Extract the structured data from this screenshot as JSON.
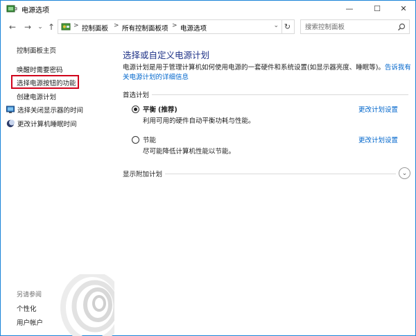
{
  "window": {
    "title": "电源选项",
    "controls": {
      "minimize": "—",
      "maximize": "☐",
      "close": "✕"
    }
  },
  "address": {
    "back": "←",
    "forward": "→",
    "dropdown": "⌄",
    "up": "↑",
    "breadcrumbs": [
      "控制面板",
      "所有控制面板项",
      "电源选项"
    ],
    "separator": ">",
    "refresh": "↻",
    "search_placeholder": "搜索控制面板"
  },
  "sidebar": {
    "home_link": "控制面板主页",
    "links": [
      "唤醒时需要密码",
      "选择电源按钮的功能",
      "创建电源计划"
    ],
    "icon_links": [
      {
        "label": "选择关闭显示器的时间",
        "icon": "monitor-icon"
      },
      {
        "label": "更改计算机睡眠时间",
        "icon": "moon-icon"
      }
    ],
    "see_also": {
      "heading": "另请参阅",
      "links": [
        "个性化",
        "用户帐户"
      ]
    }
  },
  "main": {
    "title": "选择或自定义电源计划",
    "description": "电源计划是用于管理计算机如何使用电源的一套硬件和系统设置(如显示器亮度、睡眠等)。",
    "description_link": "告诉我有关电源计划的详细信息",
    "preferred_heading": "首选计划",
    "plans": [
      {
        "name": "平衡",
        "tag": "(推荐)",
        "desc": "利用可用的硬件自动平衡功耗与性能。",
        "selected": true,
        "link": "更改计划设置"
      },
      {
        "name": "节能",
        "tag": "",
        "desc": "尽可能降低计算机性能以节能。",
        "selected": false,
        "link": "更改计划设置"
      }
    ],
    "additional_heading": "显示附加计划"
  },
  "colors": {
    "link": "#0066cc",
    "title": "#1e3287",
    "highlight": "#d0021b",
    "window_border": "#1883d7"
  }
}
